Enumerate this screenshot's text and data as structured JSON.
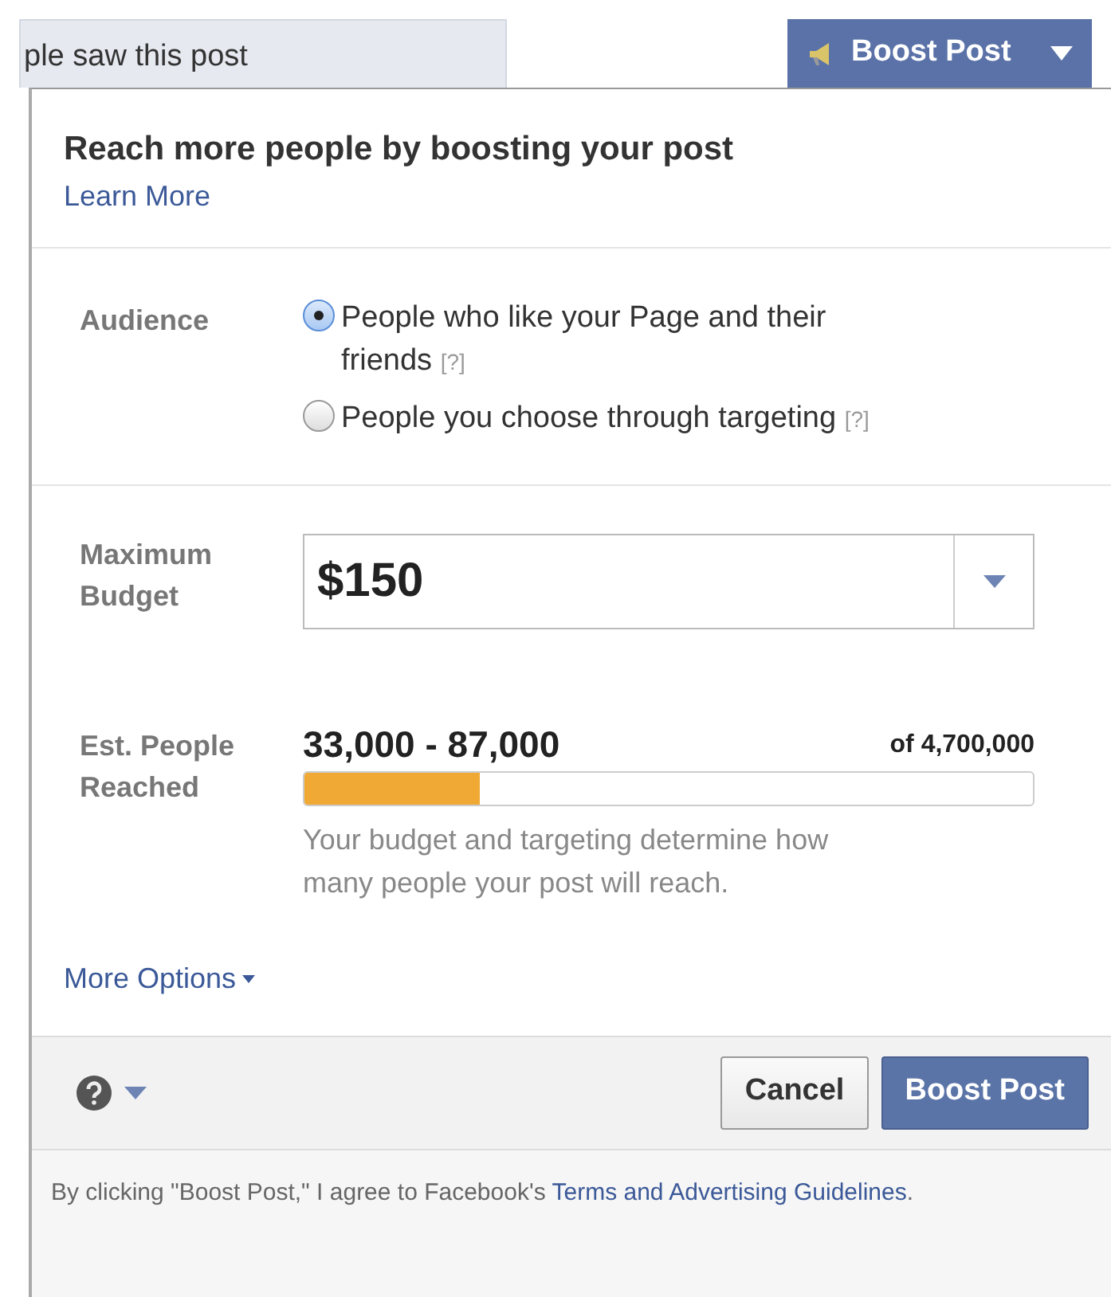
{
  "behind": {
    "reach_text": "ple saw this post"
  },
  "boost_menu": {
    "label": "Boost Post"
  },
  "popup": {
    "title": "Reach more people by boosting your post",
    "learn_more": "Learn More",
    "audience": {
      "label": "Audience",
      "options": [
        {
          "text": "People who like your Page and their friends",
          "hint": "[?]",
          "selected": true
        },
        {
          "text": "People you choose through targeting",
          "hint": "[?]",
          "selected": false
        }
      ]
    },
    "budget": {
      "label": "Maximum Budget",
      "value": "$150"
    },
    "reach": {
      "label": "Est. People Reached",
      "range": "33,000 - 87,000",
      "total": "of 4,700,000",
      "level": 0.24,
      "note": "Your budget and targeting determine how many people your post will reach."
    },
    "more_options": "More Options",
    "buttons": [
      {
        "label": "Cancel",
        "kind": "secondary"
      },
      {
        "label": "Boost Post",
        "kind": "primary"
      }
    ],
    "disclaimer": {
      "text": "By clicking \"Boost Post,\" I agree to Facebook's ",
      "link": "Terms and Advertising Guidelines",
      "end": "."
    }
  }
}
